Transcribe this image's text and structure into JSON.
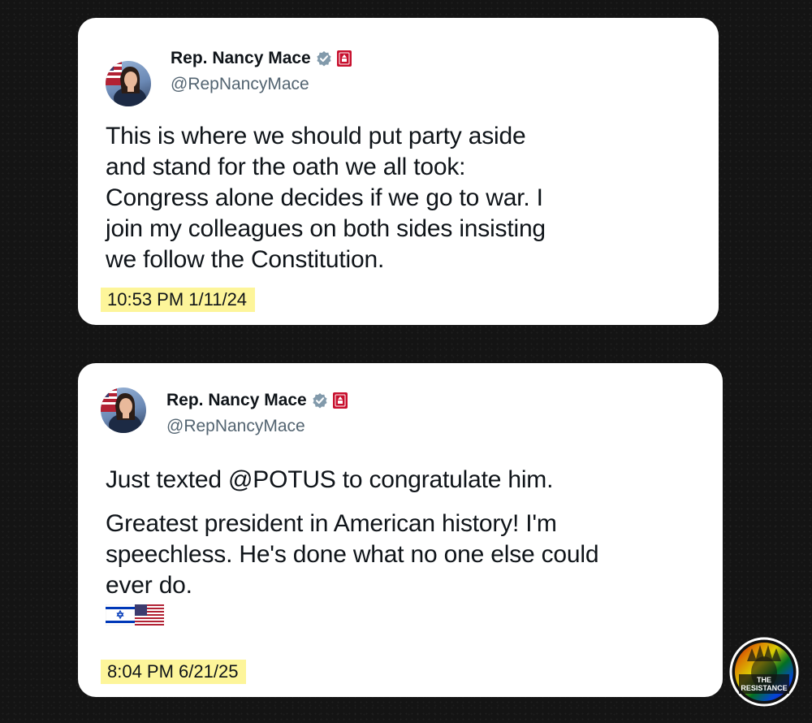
{
  "tweets": [
    {
      "author": {
        "name": "Rep. Nancy Mace",
        "handle": "@RepNancyMace",
        "avatar_icon": "profile-photo",
        "verified_icon": "verified-badge-icon",
        "affiliation_icon": "us-house-badge-icon"
      },
      "text": "This is where we should put party aside\nand stand for the oath we all took:\nCongress alone decides if we go to war. I\njoin my colleagues on both sides insisting\nwe follow the Constitution.",
      "timestamp": "10:53 PM  1/11/24"
    },
    {
      "author": {
        "name": "Rep. Nancy Mace",
        "handle": "@RepNancyMace",
        "avatar_icon": "profile-photo",
        "verified_icon": "verified-badge-icon",
        "affiliation_icon": "us-house-badge-icon"
      },
      "text_paragraph_1": "Just texted @POTUS to congratulate him.",
      "text_paragraph_2": "Greatest president in American history! I'm\nspeechless. He's done what no one else could\never do.",
      "emoji": [
        "israel-flag-icon",
        "us-flag-icon"
      ],
      "timestamp": "8:04 PM  6/21/25"
    }
  ],
  "watermark": {
    "line_1": "THE",
    "line_2": "RESISTANCE",
    "icon": "statue-of-liberty-rainbow-logo"
  },
  "colors": {
    "background": "#141414",
    "card": "#ffffff",
    "verified": "#829aab",
    "house_badge": "#c8102e",
    "timestamp_highlight": "#fdf59a",
    "handle": "#536471"
  }
}
